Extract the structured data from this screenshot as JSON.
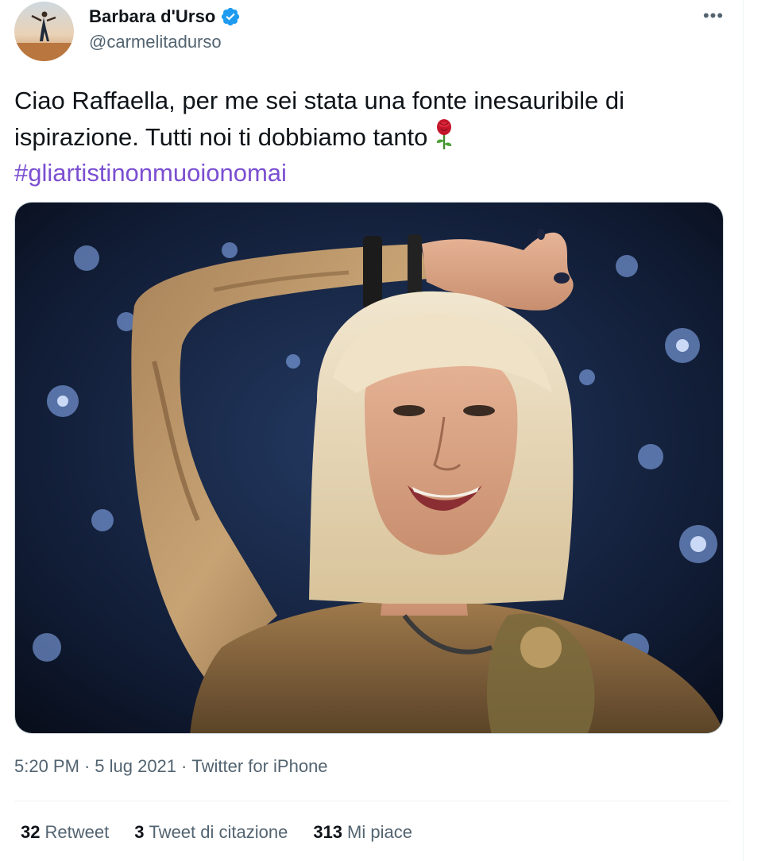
{
  "author": {
    "name": "Barbara d'Urso",
    "handle": "@carmelitadurso",
    "verified": true
  },
  "tweet": {
    "text_line1": "Ciao Raffaella, per me sei stata una fonte inesauribile di",
    "text_line2": "ispirazione. Tutti noi ti dobbiamo tanto",
    "emoji": "rose",
    "hashtag": "#gliartistinonmuoionomai"
  },
  "meta": {
    "time": "5:20 PM",
    "separator1": "·",
    "date": "5 lug 2021",
    "separator2": "·",
    "source": "Twitter for iPhone"
  },
  "stats": {
    "retweets_count": "32",
    "retweets_label": "Retweet",
    "quotes_count": "3",
    "quotes_label": "Tweet di citazione",
    "likes_count": "313",
    "likes_label": "Mi piace"
  },
  "colors": {
    "hashtag": "#7b4fd1",
    "verified": "#1d9bf0",
    "secondary_text": "#536471"
  },
  "icons": {
    "verified": "verified-badge-icon",
    "more": "more-horizontal-icon",
    "emoji": "rose-emoji-icon"
  }
}
